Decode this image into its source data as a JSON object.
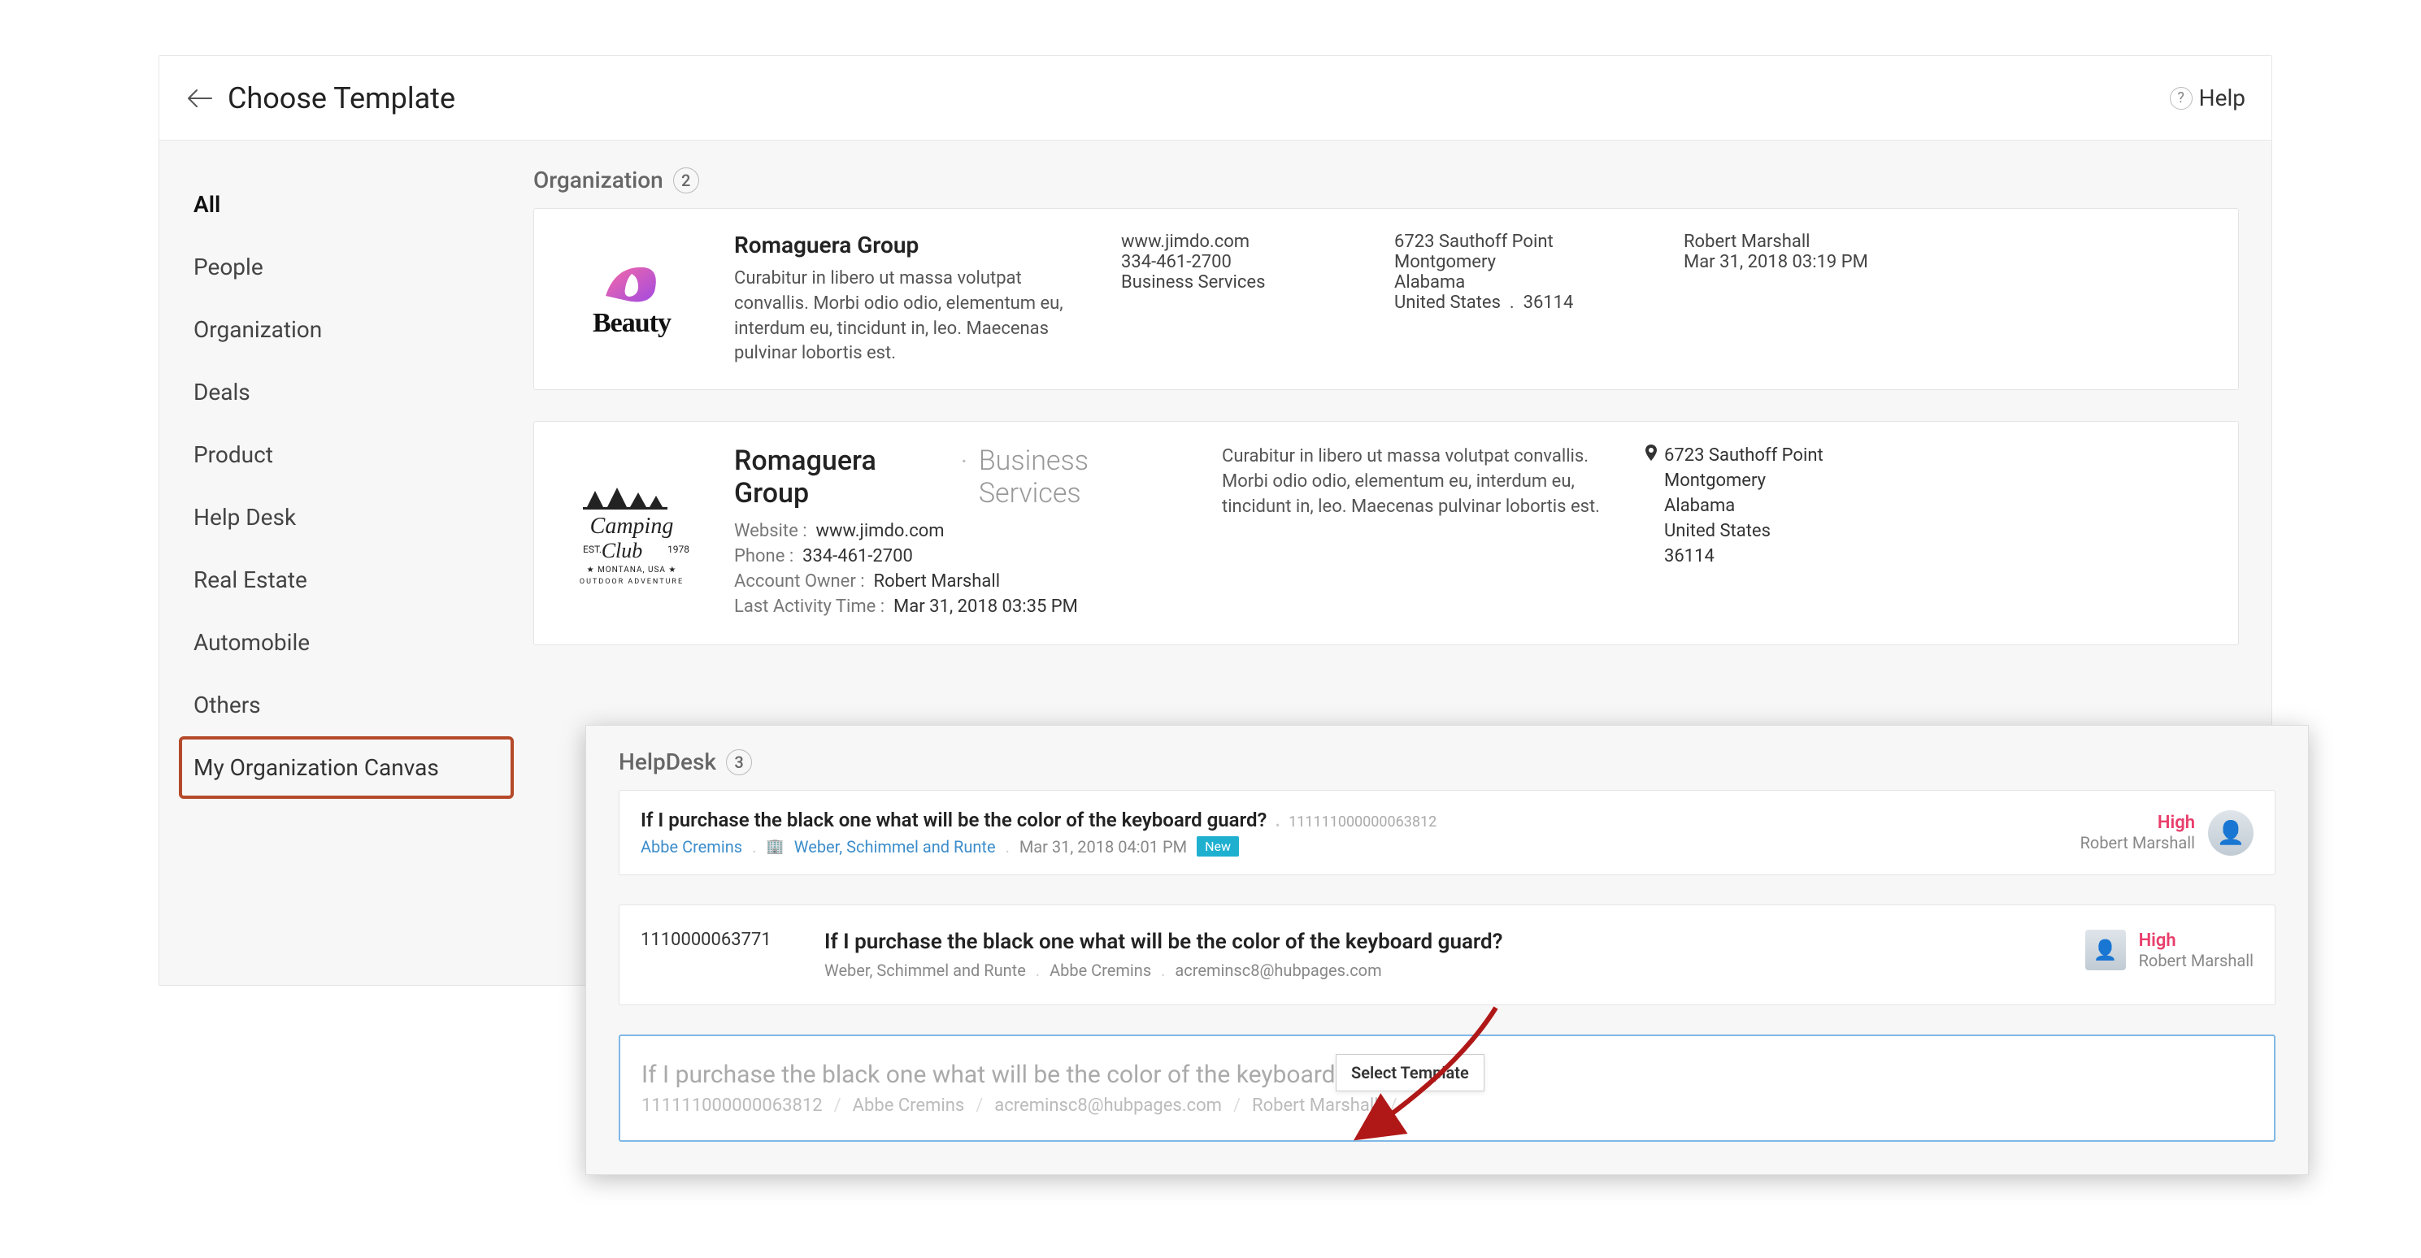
{
  "header": {
    "title": "Choose Template",
    "help": "Help"
  },
  "sidebar": {
    "items": [
      {
        "label": "All",
        "active": true
      },
      {
        "label": "People"
      },
      {
        "label": "Organization"
      },
      {
        "label": "Deals"
      },
      {
        "label": "Product"
      },
      {
        "label": "Help Desk"
      },
      {
        "label": "Real Estate"
      },
      {
        "label": "Automobile"
      },
      {
        "label": "Others"
      },
      {
        "label": "My Organization Canvas",
        "highlight": true
      }
    ]
  },
  "org_section": {
    "label": "Organization",
    "count": "2"
  },
  "card1": {
    "logo_text": "Beauty",
    "name": "Romaguera Group",
    "desc": "Curabitur in libero ut massa volutpat convallis. Morbi odio odio, elementum eu, interdum eu, tincidunt in, leo. Maecenas pulvinar lobortis est.",
    "site": "www.jimdo.com",
    "phone": "334-461-2700",
    "industry": "Business Services",
    "addr": {
      "street": "6723 Sauthoff Point",
      "city": "Montgomery",
      "state": "Alabama",
      "country": "United States",
      "zip": "36114"
    },
    "owner": "Robert Marshall",
    "date": "Mar 31, 2018 03:19 PM"
  },
  "card2": {
    "name": "Romaguera Group",
    "sub": "Business Services",
    "website_lbl": "Website :",
    "website_val": "www.jimdo.com",
    "phone_lbl": "Phone :",
    "phone_val": "334-461-2700",
    "owner_lbl": "Account Owner :",
    "owner_val": "Robert Marshall",
    "activity_lbl": "Last Activity Time :",
    "activity_val": "Mar 31, 2018 03:35 PM",
    "desc": "Curabitur in libero ut massa volutpat convallis. Morbi odio odio, elementum eu, interdum eu, tincidunt in, leo. Maecenas pulvinar lobortis est.",
    "addr": {
      "street": "6723 Sauthoff Point",
      "city": "Montgomery",
      "state": "Alabama",
      "country": "United States",
      "zip": "36114"
    }
  },
  "helpdesk": {
    "label": "HelpDesk",
    "count": "3"
  },
  "t1": {
    "title": "If I purchase the black one what will be the color of the keyboard guard?",
    "id": "111111000000063812",
    "link1": "Abbe Cremins",
    "link2": "Weber, Schimmel and Runte",
    "date": "Mar 31, 2018 04:01 PM",
    "badge": "New",
    "priority": "High",
    "owner": "Robert Marshall"
  },
  "t2": {
    "id": "1110000063771",
    "title": "If I purchase the black one what will be the color of the keyboard guard?",
    "m1": "Weber, Schimmel and Runte",
    "m2": "Abbe Cremins",
    "m3": "acreminsc8@hubpages.com",
    "priority": "High",
    "owner": "Robert Marshall"
  },
  "t3": {
    "title": "If I purchase the black one what will be the color of the keyboard",
    "m1": "111111000000063812",
    "m2": "Abbe Cremins",
    "m3": "acreminsc8@hubpages.com",
    "m4": "Robert Marshall",
    "select_btn": "Select Template"
  }
}
